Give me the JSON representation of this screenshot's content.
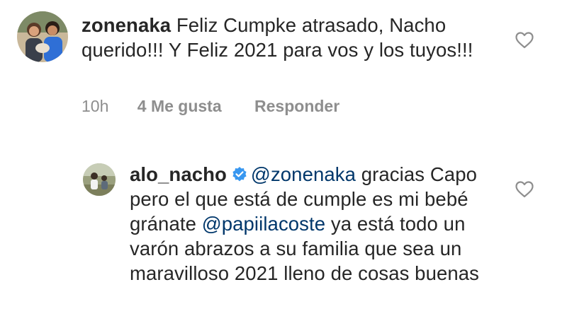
{
  "comment1": {
    "username": "zonenaka",
    "text": "Feliz Cumpke atrasado, Nacho querido!!! Y Feliz 2021 para vos y los tuyos!!!",
    "time": "10h",
    "likes": "4 Me gusta",
    "reply_label": "Responder",
    "like_icon": "heart-outline-icon"
  },
  "reply1": {
    "username": "alo_nacho",
    "verified_icon": "verified-badge-icon",
    "mention1": "@zonenaka",
    "text1": " gracias Capo pero el que está de cumple es mi bebé gránate ",
    "mention2": "@papiilacoste",
    "text2": "  ya está todo un varón abrazos a su familia que sea un maravilloso 2021 lleno de cosas buenas",
    "like_icon": "heart-outline-icon"
  },
  "colors": {
    "text": "#262626",
    "secondary": "#8e8e8e",
    "mention": "#00376b",
    "verified": "#3897f0"
  }
}
